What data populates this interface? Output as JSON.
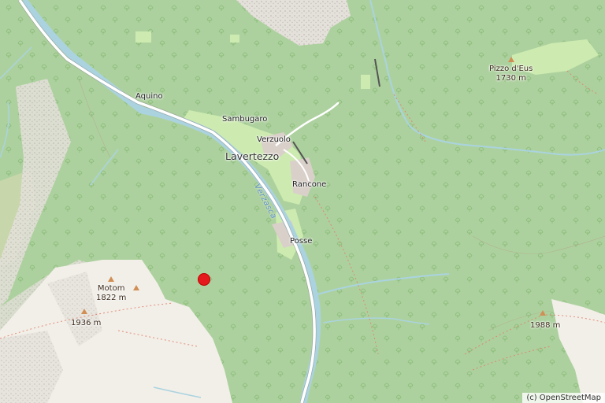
{
  "map": {
    "places": {
      "aquino": "Aquino",
      "sambugaro": "Sambugaro",
      "verzuolo": "Verzuolo",
      "lavertezzo": "Lavertezzo",
      "rancone": "Rancone",
      "posse": "Posse"
    },
    "river": "Verzasca",
    "peaks": {
      "pizzo_deus_name": "Pizzo d'Eus",
      "pizzo_deus_elev": "1730 m",
      "motom_name": "Motom",
      "motom_elev": "1822 m",
      "peak_1936": "1936 m",
      "peak_1988": "1988 m"
    },
    "attribution": "(c) OpenStreetMap",
    "colors": {
      "forest": "#add19e",
      "meadow": "#cdebb0",
      "rock": "#f2efe9",
      "water": "#aad3df",
      "road": "#ffffff",
      "marker": "#e41a1c",
      "peak": "#d08f55"
    },
    "marker_icon": "red-dot-marker"
  }
}
